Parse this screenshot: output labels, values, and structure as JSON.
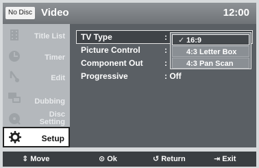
{
  "header": {
    "badge": "No Disc",
    "title": "Video",
    "clock": "12:00"
  },
  "sidebar": {
    "items": [
      {
        "label": "Title List",
        "icon": "film-icon"
      },
      {
        "label": "Timer",
        "icon": "clock-icon"
      },
      {
        "label": "Edit",
        "icon": "scissors-icon"
      },
      {
        "label": "Dubbing",
        "icon": "dubbing-icon"
      },
      {
        "label1": "Disc",
        "label2": "Setting",
        "icon": "disc-icon"
      },
      {
        "label": "Setup",
        "icon": "gear-icon",
        "active": true
      }
    ]
  },
  "settings": {
    "rows": [
      {
        "label": "TV Type",
        "value": ": 16:9"
      },
      {
        "label": "Picture Control",
        "value": ":"
      },
      {
        "label": "Component Out",
        "value": ":"
      },
      {
        "label": "Progressive",
        "value": ": Off"
      }
    ]
  },
  "dropdown": {
    "options": [
      "16:9",
      "4:3 Letter Box",
      "4:3 Pan Scan"
    ],
    "selected_index": 0
  },
  "footer": {
    "move": "Move",
    "ok": "Ok",
    "return": "Return",
    "exit": "Exit"
  },
  "colors": {
    "panel": "#5a5f64",
    "sidebar": "#b4b8bc",
    "header": "#7d8185",
    "footer": "#3a3e42"
  }
}
